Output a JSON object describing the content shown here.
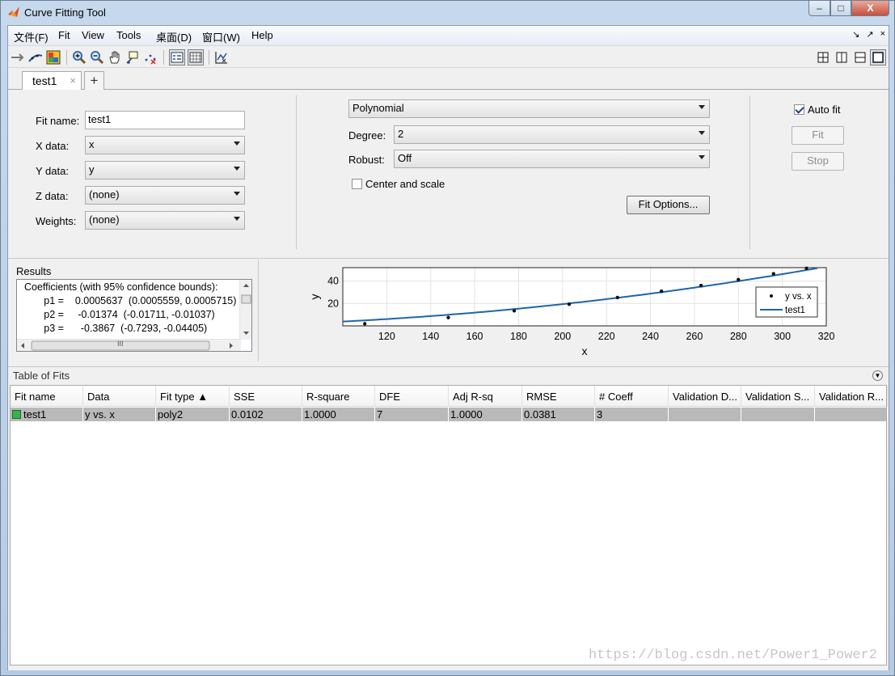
{
  "window": {
    "title": "Curve Fitting Tool",
    "min": "–",
    "max": "□",
    "close": "X"
  },
  "menu": {
    "items": [
      "文件(F)",
      "Fit",
      "View",
      "Tools",
      "桌面(D)",
      "窗口(W)",
      "Help"
    ],
    "right": [
      "↘",
      "↗",
      "×"
    ]
  },
  "tabs": {
    "active": "test1",
    "close": "×",
    "add": "+"
  },
  "fit_panel": {
    "fit_name_label": "Fit name:",
    "fit_name_value": "test1",
    "x_label": "X data:",
    "x_value": "x",
    "y_label": "Y data:",
    "y_value": "y",
    "z_label": "Z data:",
    "z_value": "(none)",
    "weights_label": "Weights:",
    "weights_value": "(none)",
    "fit_type": "Polynomial",
    "degree_label": "Degree:",
    "degree_value": "2",
    "robust_label": "Robust:",
    "robust_value": "Off",
    "center_scale_label": "Center and scale",
    "center_scale_checked": false,
    "fit_options_button": "Fit Options...",
    "auto_fit_label": "Auto fit",
    "auto_fit_checked": true,
    "fit_button": "Fit",
    "stop_button": "Stop"
  },
  "results": {
    "title": "Results",
    "lines": [
      "Coefficients (with 95% confidence bounds):",
      "       p1 =    0.0005637  (0.0005559, 0.0005715)",
      "       p2 =     -0.01374  (-0.01711, -0.01037)",
      "       p3 =      -0.3867  (-0.7293, -0.04405)"
    ],
    "scroll_grip": "III"
  },
  "chart_data": {
    "type": "scatter",
    "xlabel": "x",
    "ylabel": "y",
    "xlim": [
      100,
      320
    ],
    "ylim": [
      0,
      52
    ],
    "xticks": [
      120,
      140,
      160,
      180,
      200,
      220,
      240,
      260,
      280,
      300,
      320
    ],
    "yticks": [
      20,
      40
    ],
    "grid": true,
    "legend": [
      "y vs. x",
      "test1"
    ],
    "legend_position": "right",
    "series": [
      {
        "name": "y vs. x",
        "kind": "points",
        "x": [
          110,
          148,
          178,
          203,
          225,
          245,
          263,
          280,
          296,
          311
        ],
        "y": [
          1.9,
          7.4,
          13.5,
          19.4,
          25.3,
          30.9,
          36.1,
          41.3,
          46.5,
          51.4
        ]
      },
      {
        "name": "test1",
        "kind": "fit",
        "coefficients": {
          "p1": 0.0005637,
          "p2": -0.01374,
          "p3": -0.3867
        }
      }
    ]
  },
  "table_of_fits": {
    "title": "Table of Fits",
    "columns": [
      "Fit name",
      "Data",
      "Fit type ▲",
      "SSE",
      "R-square",
      "DFE",
      "Adj R-sq",
      "RMSE",
      "# Coeff",
      "Validation D...",
      "Validation S...",
      "Validation R..."
    ],
    "rows": [
      [
        "test1",
        "y vs. x",
        "poly2",
        "0.0102",
        "1.0000",
        "7",
        "1.0000",
        "0.0381",
        "3",
        "",
        "",
        ""
      ]
    ]
  },
  "watermark": "https://blog.csdn.net/Power1_Power2"
}
